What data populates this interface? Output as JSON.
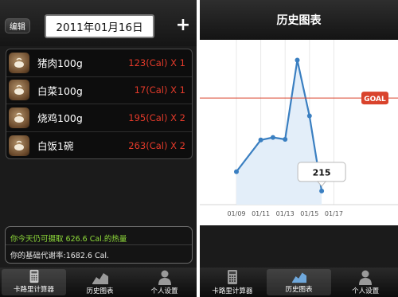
{
  "left": {
    "edit_label": "编辑",
    "date": "2011年01月16日",
    "add_label": "+",
    "foods": [
      {
        "name": "猪肉100g",
        "cal": "123(Cal) X 1"
      },
      {
        "name": "白菜100g",
        "cal": "17(Cal) X 1"
      },
      {
        "name": "烧鸡100g",
        "cal": "195(Cal) X 2"
      },
      {
        "name": "白饭1碗",
        "cal": "263(Cal) X 2"
      }
    ],
    "summary_intake": "你今天仍可摄取 626.6 Cal.的热量",
    "summary_bmr": "你的基础代谢率:1682.6 Cal.",
    "tabs": [
      {
        "label": "卡路里计算器",
        "icon": "calculator-icon",
        "active": true
      },
      {
        "label": "历史图表",
        "icon": "chart-icon",
        "active": false
      },
      {
        "label": "个人设置",
        "icon": "person-icon",
        "active": false
      }
    ]
  },
  "right": {
    "title": "历史图表",
    "goal_label": "GOAL",
    "tooltip_value": "215",
    "tabs": [
      {
        "label": "卡路里计算器",
        "icon": "calculator-icon",
        "active": false
      },
      {
        "label": "历史图表",
        "icon": "chart-icon",
        "active": true
      },
      {
        "label": "个人设置",
        "icon": "person-icon",
        "active": false
      }
    ]
  },
  "chart_data": {
    "type": "area",
    "x_ticks": [
      "01/09",
      "01/11",
      "01/13",
      "01/15",
      "01/17"
    ],
    "points": [
      {
        "x": "01/09",
        "y": 520
      },
      {
        "x": "01/11",
        "y": 1020
      },
      {
        "x": "01/12",
        "y": 1060
      },
      {
        "x": "01/13",
        "y": 1030
      },
      {
        "x": "01/14",
        "y": 2280
      },
      {
        "x": "01/15",
        "y": 1400
      },
      {
        "x": "01/16",
        "y": 215
      }
    ],
    "goal": 1682.6,
    "ylim": [
      0,
      2500
    ],
    "colors": {
      "line": "#3a7fc1",
      "fill": "#e3eef9",
      "goal": "#d9432c"
    }
  }
}
